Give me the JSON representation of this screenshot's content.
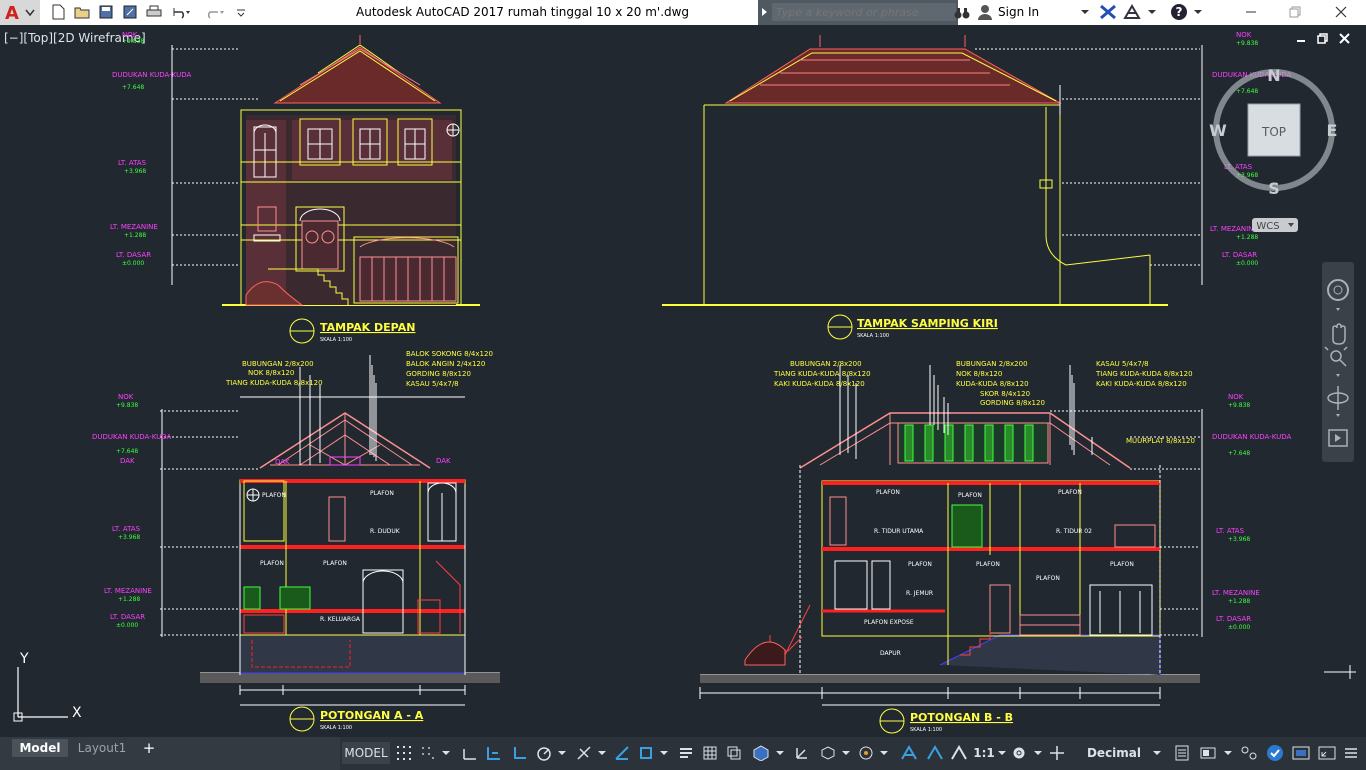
{
  "titlebar": {
    "app_letter": "A",
    "title": "Autodesk AutoCAD 2017    rumah tinggal 10 x 20 m'.dwg",
    "search_placeholder": "Type a keyword or phrase",
    "sign_in": "Sign In",
    "help": "?"
  },
  "viewport": {
    "label": "[−][Top][2D Wireframe]"
  },
  "viewcube": {
    "north": "N",
    "south": "S",
    "east": "E",
    "west": "W",
    "top": "TOP",
    "wcs": "WCS"
  },
  "ucs": {
    "x": "X",
    "y": "Y"
  },
  "drawings": {
    "front_title": "TAMPAK DEPAN",
    "side_title": "TAMPAK SAMPING KIRI",
    "section_a_title": "POTONGAN A - A",
    "section_b_title": "POTONGAN B - B",
    "scale": "SKALA 1:100",
    "levels_left": [
      "NOK",
      "DUDUKAN KUDA-KUDA",
      "LT. ATAS",
      "LT. MEZANINE",
      "LT. DASAR"
    ],
    "levels_right": [
      "NOK",
      "DUDUKAN KUDA-KUDA",
      "LT. ATAS",
      "LT. MEZANINE",
      "LT. DASAR"
    ],
    "levels_sec_left": [
      "NOK",
      "DUDUKAN KUDA-KUDA",
      "DAK",
      "LT. ATAS",
      "LT. MEZANINE",
      "LT. DASAR"
    ],
    "levels_sec_right": [
      "NOK",
      "DUDUKAN KUDA-KUDA",
      "LT. ATAS",
      "LT. MEZANINE",
      "LT. DASAR"
    ],
    "elevations": [
      "+9.838",
      "+7.648",
      "+3.968",
      "+1.288",
      "±0.000"
    ],
    "sec_a_notes": [
      "BUBUNGAN 2/8x200",
      "NOK 8/8x120",
      "TIANG KUDA-KUDA 8/8x120",
      "BALOK SOKONG 8/4x120",
      "BALOK ANGIN 2/4x120",
      "GORDING 8/8x120",
      "KASAU 5/4x7/8"
    ],
    "sec_b_notes_left": [
      "BUBUNGAN 2/8x200",
      "TIANG KUDA-KUDA 8/8x120",
      "KAKI KUDA-KUDA 8/8x120"
    ],
    "sec_b_notes_mid": [
      "BUBUNGAN 2/8x200",
      "NOK 8/8x120",
      "KUDA-KUDA 8/8x120",
      "SKOR 8/4x120",
      "GORDING 8/8x120"
    ],
    "sec_b_notes_right": [
      "KASAU 5/4x7/8",
      "TIANG KUDA-KUDA 8/8x120",
      "KAKI KUDA-KUDA 8/8x120"
    ],
    "muurplat": "MUURPLAT 8/8x120",
    "rooms_a": [
      "PLAFON",
      "PLAFON",
      "PLAFON",
      "PLAFON",
      "R. DUDUK",
      "R. KELUARGA",
      "DAK",
      "DAK"
    ],
    "rooms_b": [
      "PLAFON",
      "PLAFON",
      "PLAFON",
      "R. TIDUR UTAMA",
      "R. TIDUR 02",
      "PLAFON",
      "PLAFON",
      "PLAFON",
      "PLAFON",
      "PLAFON EXPOSE",
      "DAPUR",
      "R. JEMUR"
    ]
  },
  "tabs": {
    "model": "Model",
    "layout": "Layout1",
    "add": "+"
  },
  "status": {
    "model": "MODEL",
    "scale": "1:1",
    "units": "Decimal"
  }
}
